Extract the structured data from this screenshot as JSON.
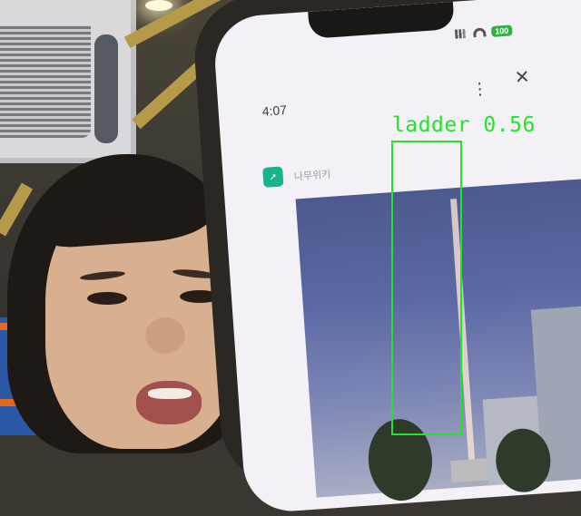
{
  "phone": {
    "status_time": "4:07",
    "battery": "100",
    "app_title": "나무위키"
  },
  "detection": {
    "label": "ladder 0.56",
    "class": "ladder",
    "confidence": 0.56,
    "box_color": "#23e22b"
  },
  "icons": {
    "status": [
      "signal-icon",
      "wifi-icon",
      "battery-icon"
    ],
    "toolbar": [
      "more-icon",
      "close-icon"
    ],
    "app": "app-icon"
  }
}
